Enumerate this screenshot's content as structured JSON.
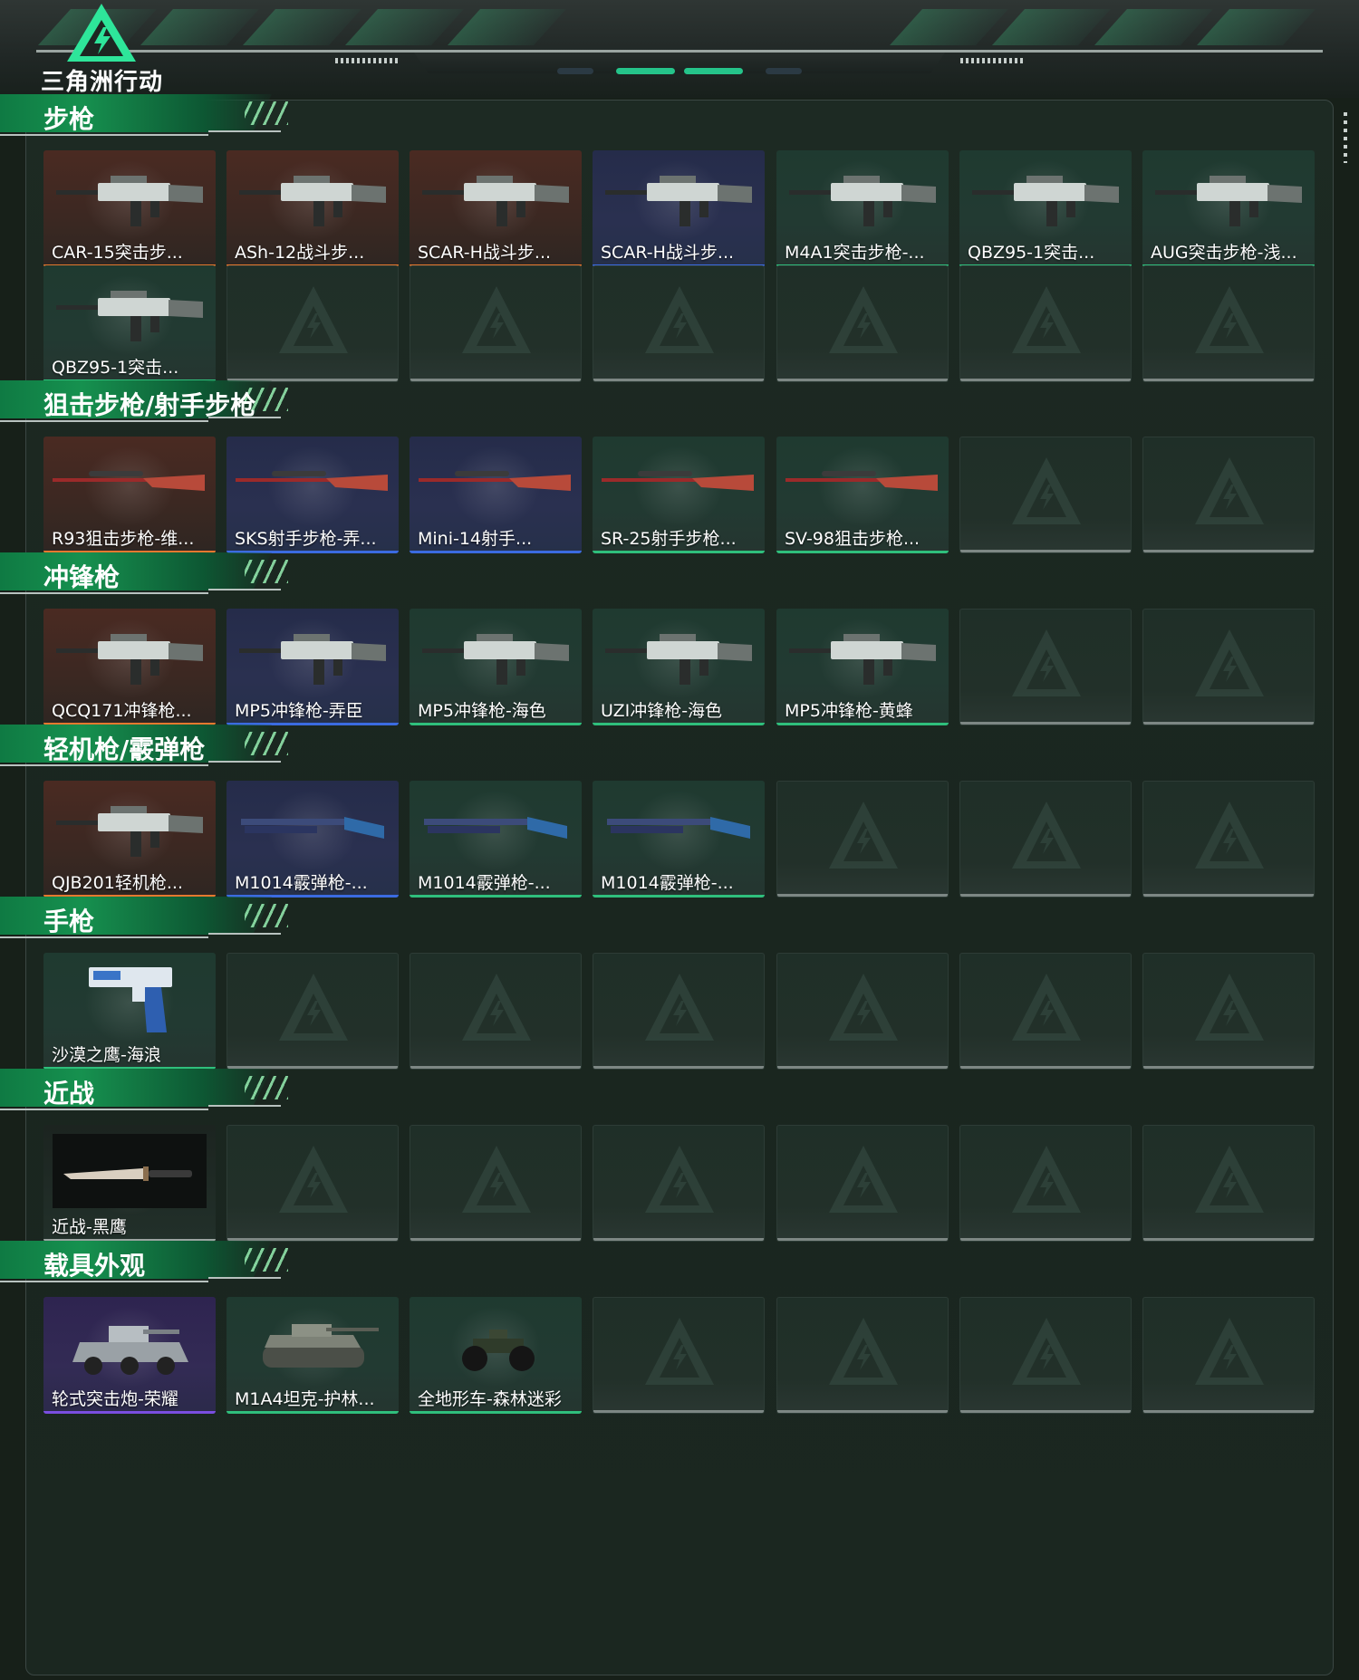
{
  "app": {
    "logo_text": "三角洲行动"
  },
  "sections": [
    {
      "title": "步枪",
      "items": [
        {
          "name": "CAR-15突击步...",
          "rarity": "orange",
          "icon": "rifle-icon"
        },
        {
          "name": "ASh-12战斗步...",
          "rarity": "orange",
          "icon": "rifle-icon"
        },
        {
          "name": "SCAR-H战斗步...",
          "rarity": "orange",
          "icon": "rifle-icon"
        },
        {
          "name": "SCAR-H战斗步...",
          "rarity": "blue",
          "icon": "rifle-icon"
        },
        {
          "name": "M4A1突击步枪-...",
          "rarity": "green",
          "icon": "rifle-icon"
        },
        {
          "name": "QBZ95-1突击...",
          "rarity": "green",
          "icon": "rifle-icon"
        },
        {
          "name": "AUG突击步枪-浅...",
          "rarity": "green",
          "icon": "rifle-icon"
        },
        {
          "name": "QBZ95-1突击...",
          "rarity": "green",
          "icon": "rifle-icon"
        }
      ],
      "slots": 14
    },
    {
      "title": "狙击步枪/射手步枪",
      "items": [
        {
          "name": "R93狙击步枪-维...",
          "rarity": "orange",
          "icon": "sniper-rifle-icon"
        },
        {
          "name": "SKS射手步枪-弄...",
          "rarity": "blue",
          "icon": "sniper-rifle-icon"
        },
        {
          "name": "Mini-14射手...",
          "rarity": "blue",
          "icon": "sniper-rifle-icon"
        },
        {
          "name": "SR-25射手步枪...",
          "rarity": "green",
          "icon": "sniper-rifle-icon"
        },
        {
          "name": "SV-98狙击步枪...",
          "rarity": "green",
          "icon": "sniper-rifle-icon"
        }
      ],
      "slots": 7
    },
    {
      "title": "冲锋枪",
      "items": [
        {
          "name": "QCQ171冲锋枪...",
          "rarity": "orange",
          "icon": "smg-icon"
        },
        {
          "name": "MP5冲锋枪-弄臣",
          "rarity": "blue",
          "icon": "smg-icon"
        },
        {
          "name": "MP5冲锋枪-海色",
          "rarity": "green",
          "icon": "smg-icon"
        },
        {
          "name": "UZI冲锋枪-海色",
          "rarity": "green",
          "icon": "smg-icon"
        },
        {
          "name": "MP5冲锋枪-黄蜂",
          "rarity": "green",
          "icon": "smg-icon"
        }
      ],
      "slots": 7
    },
    {
      "title": "轻机枪/霰弹枪",
      "items": [
        {
          "name": "QJB201轻机枪...",
          "rarity": "orange",
          "icon": "lmg-icon"
        },
        {
          "name": "M1014霰弹枪-...",
          "rarity": "blue",
          "icon": "shotgun-icon"
        },
        {
          "name": "M1014霰弹枪-...",
          "rarity": "green",
          "icon": "shotgun-icon"
        },
        {
          "name": "M1014霰弹枪-...",
          "rarity": "green",
          "icon": "shotgun-icon"
        }
      ],
      "slots": 7
    },
    {
      "title": "手枪",
      "items": [
        {
          "name": "沙漠之鹰-海浪",
          "rarity": "green",
          "icon": "pistol-icon"
        }
      ],
      "slots": 7
    },
    {
      "title": "近战",
      "items": [
        {
          "name": "近战-黑鹰",
          "rarity": "none",
          "icon": "knife-icon"
        }
      ],
      "slots": 7
    },
    {
      "title": "载具外观",
      "items": [
        {
          "name": "轮式突击炮-荣耀",
          "rarity": "purple",
          "icon": "armored-car-icon"
        },
        {
          "name": "M1A4坦克-护林...",
          "rarity": "green",
          "icon": "tank-icon"
        },
        {
          "name": "全地形车-森林迷彩",
          "rarity": "green",
          "icon": "atv-icon"
        }
      ],
      "slots": 7
    }
  ],
  "colors": {
    "orange": "#e5782f",
    "blue": "#3b6be0",
    "green": "#2fbf7c",
    "purple": "#7a4ee0",
    "accent": "#16914f"
  }
}
